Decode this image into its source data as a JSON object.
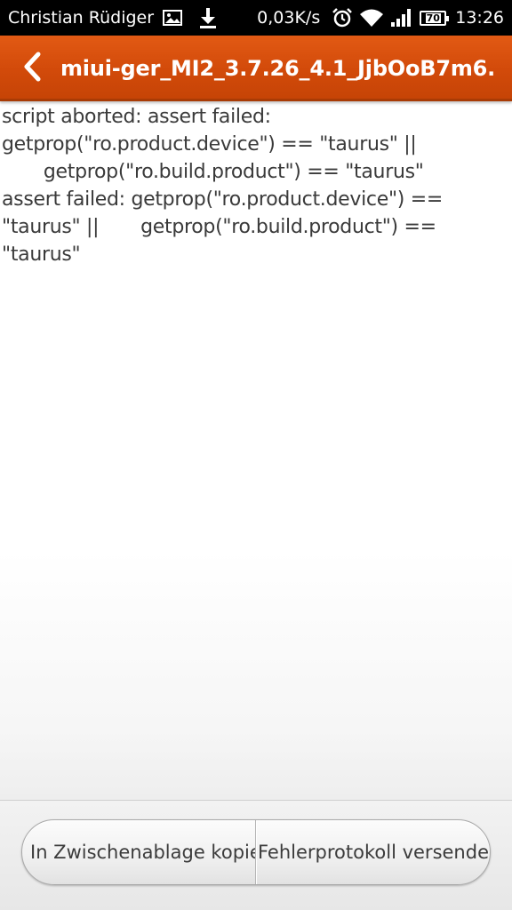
{
  "status_bar": {
    "carrier": "Christian Rüdiger",
    "speed": "0,03K/s",
    "battery_level": "70",
    "time": "13:26",
    "icons": [
      "image-icon",
      "download-icon",
      "alarm-icon",
      "wifi-icon",
      "signal-icon",
      "battery-icon"
    ]
  },
  "header": {
    "title": "miui-ger_MI2_3.7.26_4.1_JjbOoB7m6.",
    "accent_color": "#d24a0a"
  },
  "log": {
    "text": "script aborted: assert failed: getprop(\"ro.product.device\") == \"taurus\" ||\n       getprop(\"ro.build.product\") == \"taurus\"\nassert failed: getprop(\"ro.product.device\") ==\n\"taurus\" ||       getprop(\"ro.build.product\") ==\n\"taurus\""
  },
  "actions": {
    "copy_label": "In Zwischenablage kopieren",
    "send_label": "Fehlerprotokoll versenden"
  }
}
